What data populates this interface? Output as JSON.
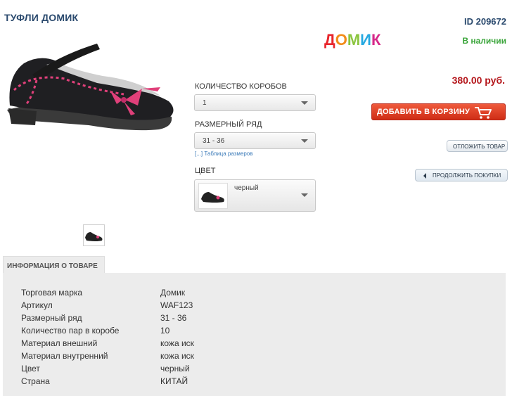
{
  "product": {
    "title": "ТУФЛИ ДОМИК",
    "id_text": "ID 209672",
    "stock": "В наличии",
    "price": "380.00 руб.",
    "brand_logo": [
      "Д",
      "О",
      "М",
      "И",
      "К"
    ],
    "brand_logo_colors": [
      "#e8262c",
      "#f28c1a",
      "#8bc53f",
      "#27a9e1",
      "#d62a8a"
    ]
  },
  "options": {
    "boxes_label": "КОЛИЧЕСТВО КОРОБОВ",
    "boxes_value": "1",
    "size_label": "РАЗМЕРНЫЙ РЯД",
    "size_value": "31 - 36",
    "size_table_link": "[...] Таблица размеров",
    "color_label": "ЦВЕТ",
    "color_value": "черный"
  },
  "actions": {
    "add_to_cart": "ДОБАВИТЬ В КОРЗИНУ",
    "defer": "ОТЛОЖИТЬ ТОВАР",
    "continue": "ПРОДОЛЖИТЬ ПОКУПКИ"
  },
  "info": {
    "tab_label": "ИНФОРМАЦИЯ О ТОВАРЕ",
    "rows": [
      {
        "key": "Торговая марка",
        "value": "Домик"
      },
      {
        "key": "Артикул",
        "value": "WAF123"
      },
      {
        "key": "Размерный ряд",
        "value": "31 - 36"
      },
      {
        "key": "Количество пар в коробе",
        "value": "10"
      },
      {
        "key": "Материал внешний",
        "value": "кожа иск"
      },
      {
        "key": "Материал внутренний",
        "value": "кожа иск"
      },
      {
        "key": "Цвет",
        "value": "черный"
      },
      {
        "key": "Страна",
        "value": "КИТАЙ"
      }
    ]
  },
  "colors": {
    "title_blue": "#2b4a6e",
    "stock_green": "#3aa53a",
    "price_red": "#b4161b",
    "cart_red": "#d9391e",
    "shoe_pink": "#e0407a"
  },
  "icons": [
    "shoe-photo",
    "shoe-thumbnail",
    "cart-icon",
    "chevron-left-icon",
    "chevron-down-icon"
  ]
}
